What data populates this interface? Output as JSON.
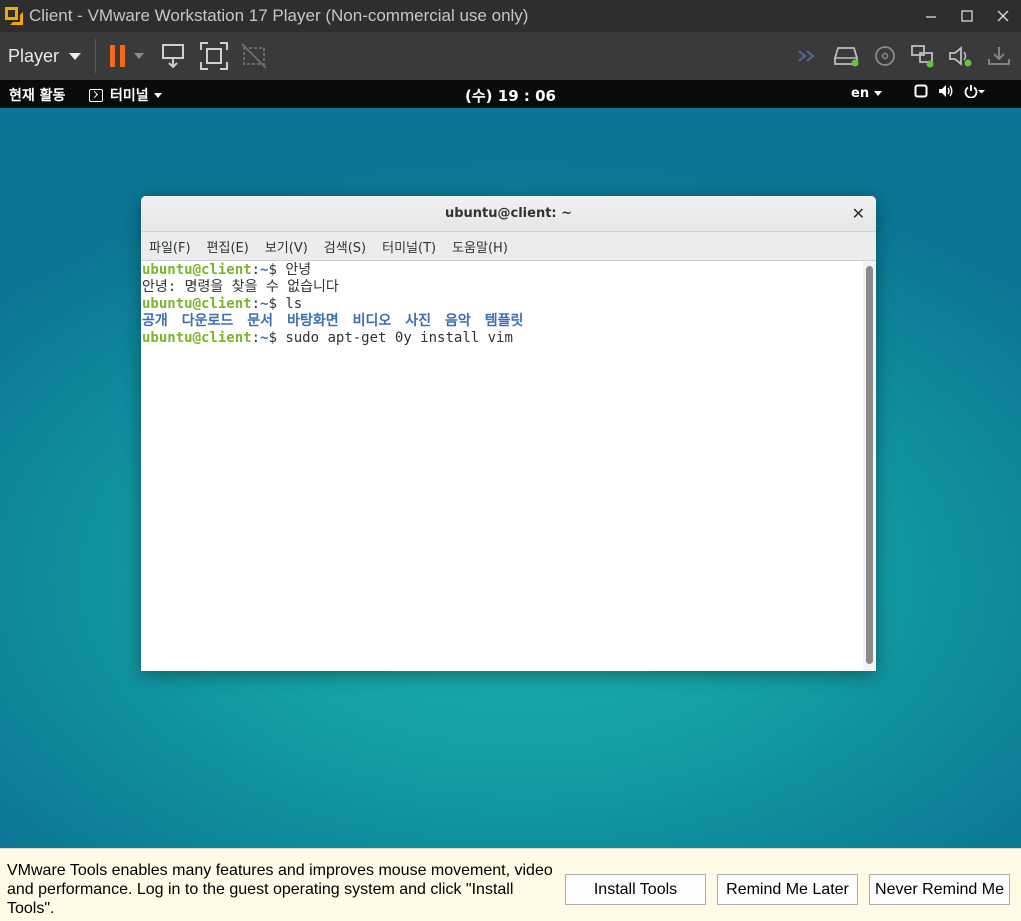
{
  "window": {
    "title": "Client - VMware Workstation 17 Player (Non-commercial use only)"
  },
  "toolbar": {
    "player_label": "Player",
    "pause_color": "#f26a1b"
  },
  "guest_topbar": {
    "activities": "현재 활동",
    "app_menu": "터미널",
    "clock": "(수) 19 : 06",
    "language": "en"
  },
  "terminal": {
    "title": "ubuntu@client: ~",
    "menu": [
      "파일(F)",
      "편집(E)",
      "보기(V)",
      "검색(S)",
      "터미널(T)",
      "도움말(H)"
    ],
    "prompt_user": "ubuntu@client",
    "prompt_sep": ":",
    "prompt_path": "~",
    "prompt_symbol": "$ ",
    "lines": [
      {
        "type": "cmd",
        "text": "안녕"
      },
      {
        "type": "out",
        "text": "안녕: 명령을 찾을 수 없습니다"
      },
      {
        "type": "cmd",
        "text": "ls"
      },
      {
        "type": "ls",
        "items": [
          "공개",
          "다운로드",
          "문서",
          "바탕화면",
          "비디오",
          "사진",
          "음악",
          "템플릿"
        ]
      },
      {
        "type": "cmd",
        "text": "sudo apt-get 0y install vim"
      }
    ]
  },
  "notification": {
    "message": "VMware Tools enables many features and improves mouse movement, video and performance. Log in to the guest operating system and click \"Install Tools\".",
    "install_button": "Install Tools",
    "remind_button": "Remind Me Later",
    "never_button": "Never Remind Me"
  }
}
